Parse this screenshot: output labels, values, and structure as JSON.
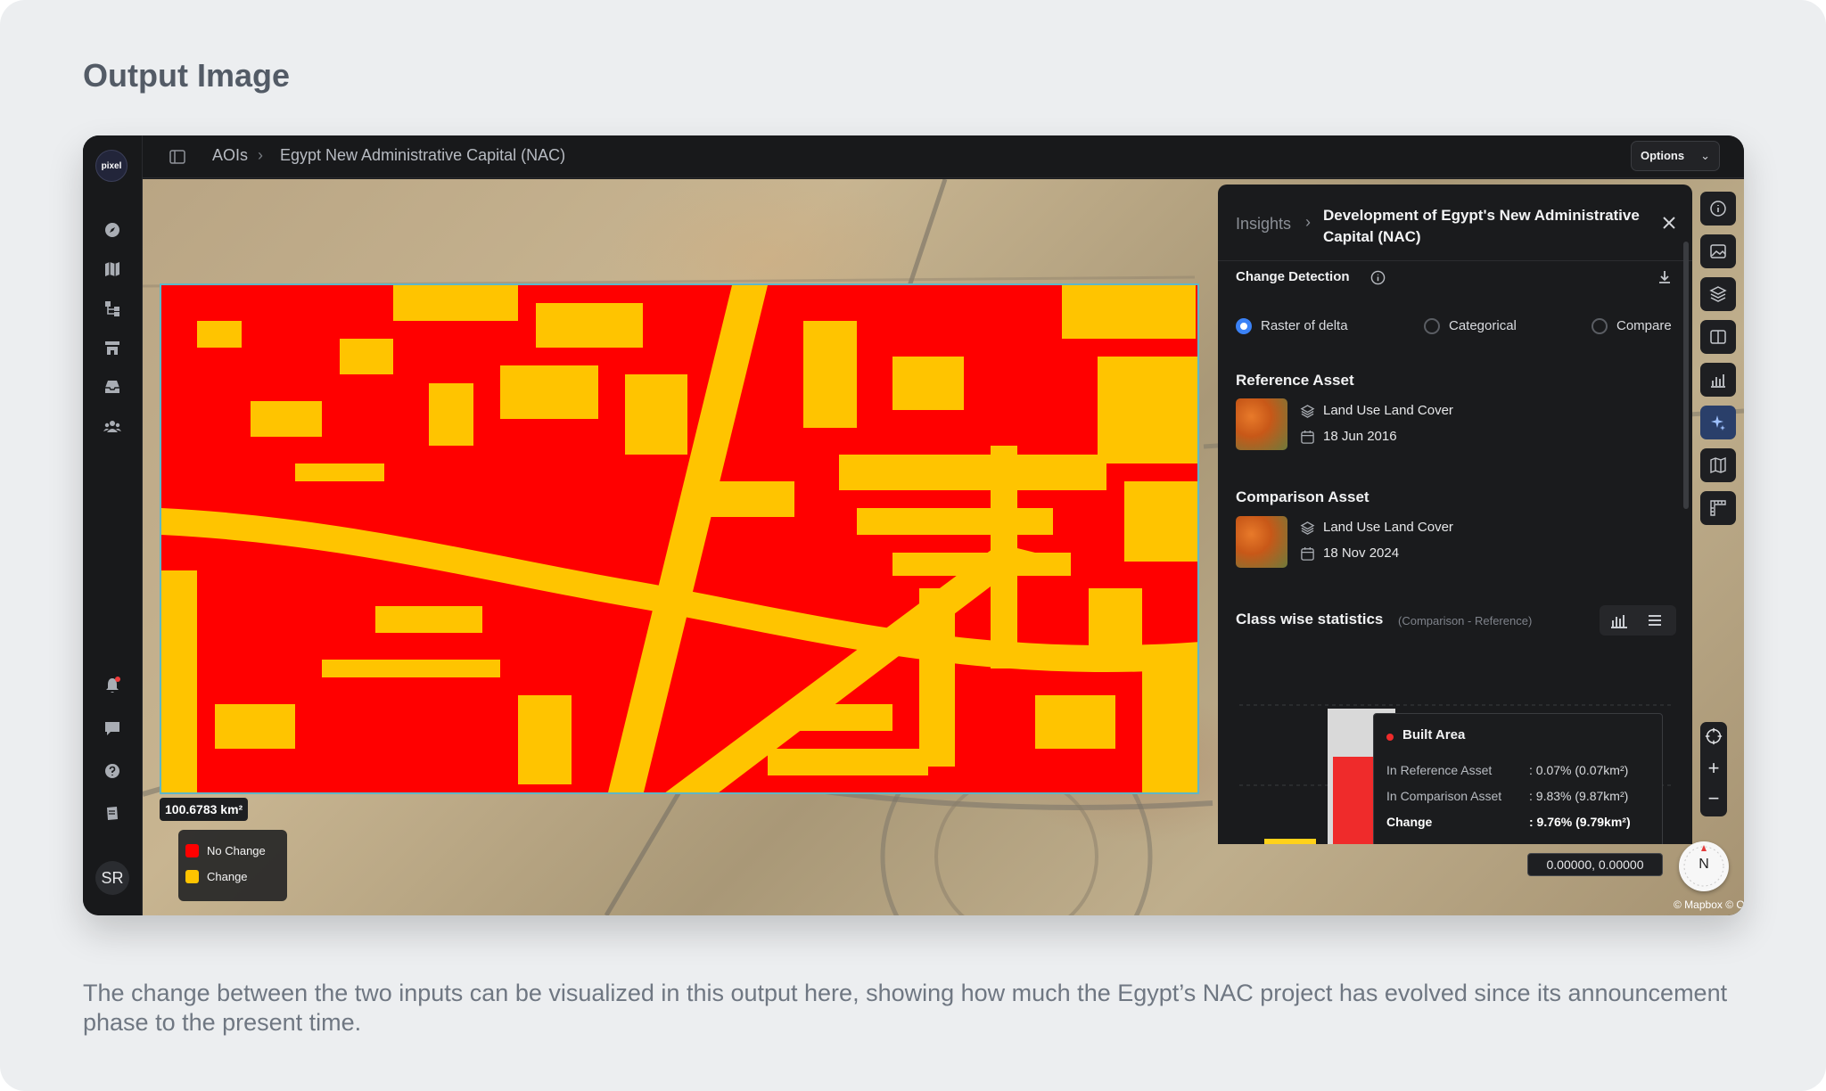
{
  "page": {
    "heading": "Output Image",
    "caption": "The change between the two inputs can be visualized in this output here, showing how much the Egypt’s NAC project has evolved since its announcement phase to the present time."
  },
  "app": {
    "logo_text": "pixel",
    "breadcrumb": [
      "AOIs",
      "Egypt New Administrative Capital (NAC)"
    ],
    "breadcrumb_sep": "›",
    "options_label": "Options",
    "avatar_initials": "SR",
    "sidebar_icons": [
      "compass-icon",
      "map-icon",
      "workflow-icon",
      "store-icon",
      "inbox-icon",
      "team-icon",
      "notification-icon",
      "feedback-icon",
      "help-icon",
      "docs-icon"
    ]
  },
  "map": {
    "area_label": "100.6783 km²",
    "legend": [
      {
        "label": "No Change",
        "color": "#ff0000"
      },
      {
        "label": "Change",
        "color": "#ffc400"
      }
    ],
    "coordinates": "0.00000, 0.00000",
    "compass_letter": "N",
    "attribution": "© Mapbox © OpenStreetMap",
    "zoom_in": "+",
    "zoom_out": "−",
    "right_tools": [
      "info-icon",
      "image-icon",
      "layers-icon",
      "split-view-icon",
      "chart-icon",
      "sparkle-icon",
      "map-icon",
      "ruler-icon"
    ]
  },
  "insights": {
    "crumb": "Insights",
    "crumb_sep": "›",
    "title": "Development of Egypt's New Administrative Capital (NAC)",
    "change_detection": {
      "title": "Change Detection",
      "options": [
        {
          "label": "Raster of delta",
          "selected": true
        },
        {
          "label": "Categorical",
          "selected": false
        },
        {
          "label": "Compare",
          "selected": false
        }
      ]
    },
    "reference": {
      "title": "Reference Asset",
      "name": "Land Use Land Cover",
      "date": "18 Jun 2016"
    },
    "comparison": {
      "title": "Comparison Asset",
      "name": "Land Use Land Cover",
      "date": "18 Nov 2024"
    },
    "stats": {
      "title": "Class wise statistics",
      "subtitle": "(Comparison - Reference)",
      "tooltip": {
        "class": "Built Area",
        "rows": [
          {
            "label": "In Reference Asset",
            "value": ": 0.07% (0.07km²)"
          },
          {
            "label": "In Comparison Asset",
            "value": ": 9.83% (9.87km²)"
          },
          {
            "label": "Change",
            "value": ": 9.76% (9.79km²)"
          }
        ]
      }
    }
  },
  "colors": {
    "accent": "#3b82f6",
    "no_change": "#ff0000",
    "change": "#ffc400",
    "built_area": "#ef2b2b"
  }
}
